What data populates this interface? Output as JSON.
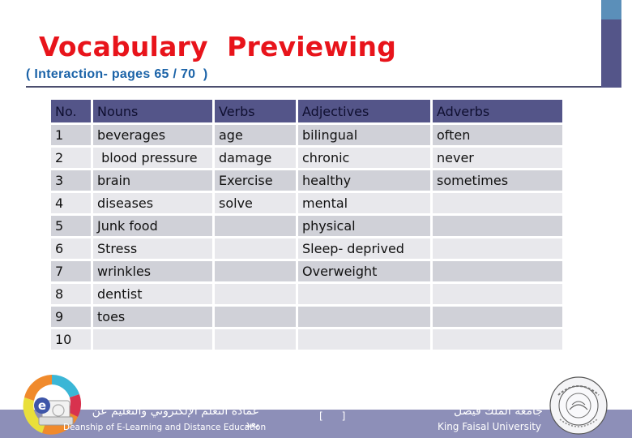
{
  "slide": {
    "title": "Vocabulary  Previewing",
    "subtitle": "( Interaction- pages 65 / 70  )"
  },
  "table": {
    "headers": [
      "No.",
      "Nouns",
      "Verbs",
      "Adjectives",
      "Adverbs"
    ],
    "rows": [
      [
        "1",
        "beverages",
        "age",
        "bilingual",
        "often"
      ],
      [
        "2",
        " blood pressure",
        "damage",
        "chronic",
        "never"
      ],
      [
        "3",
        "brain",
        "Exercise",
        "healthy",
        "sometimes"
      ],
      [
        "4",
        "diseases",
        "solve",
        "mental",
        ""
      ],
      [
        "5",
        "Junk food",
        "",
        "physical",
        ""
      ],
      [
        "6",
        "Stress",
        "",
        "Sleep- deprived",
        ""
      ],
      [
        "7",
        "wrinkles",
        "",
        "Overweight",
        ""
      ],
      [
        "8",
        "dentist",
        "",
        "",
        ""
      ],
      [
        "9",
        "toes",
        "",
        "",
        ""
      ],
      [
        "10",
        "",
        "",
        "",
        ""
      ]
    ]
  },
  "footer": {
    "deanship_arabic": "عمادة التعلم الإلكتروني والتعليم عن بعد",
    "deanship_english": "Deanship of E-Learning and Distance Education",
    "page_marker": "[      ]",
    "university_arabic": "جامعة الملك فيصل",
    "university_english": "King Faisal University"
  },
  "icons": {
    "left_logo": "elearning-logo-icon",
    "right_logo": "university-seal-icon"
  },
  "colors": {
    "title": "#e8141b",
    "subtitle": "#1b63a8",
    "header_row": "#545589",
    "row_dark": "#d0d1d8",
    "row_light": "#e8e8ec",
    "footer_band": "#8d8fb8",
    "accent_bar_top": "#5b8fb9",
    "accent_bar_bottom": "#545589"
  }
}
